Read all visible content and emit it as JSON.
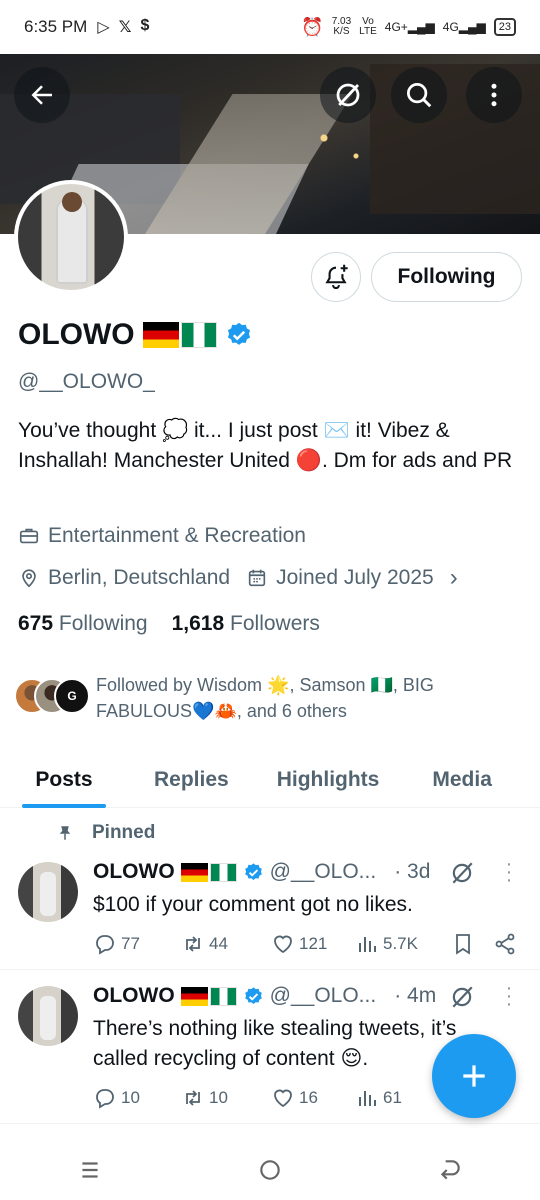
{
  "status_bar": {
    "time": "6:35 PM",
    "speed_value": "7.03",
    "speed_unit": "K/S",
    "carrier_top": "Vo",
    "carrier_bottom": "LTE",
    "net1": "4G+",
    "net2": "4G",
    "battery": "23",
    "icons": [
      "media-output-icon",
      "x-app-icon",
      "s-app-icon",
      "alarm-icon",
      "signal-icon",
      "battery-icon"
    ]
  },
  "header": {
    "icons": [
      "back-arrow-icon",
      "grok-icon",
      "search-icon",
      "more-vertical-icon"
    ]
  },
  "profile": {
    "following_button": "Following",
    "display_name": "OLOWO",
    "handle": "@__OLOWO_",
    "bio": "You’ve thought 💭 it... I just post ✉️ it! Vibez & Inshallah! Manchester United 🔴. Dm for ads and PR",
    "category": "Entertainment & Recreation",
    "location": "Berlin, Deutschland",
    "joined": "Joined July 2025",
    "following_count": "675",
    "following_label": "Following",
    "followers_count": "1,618",
    "followers_label": "Followers",
    "followed_by": "Followed by Wisdom 🌟, Samson 🇳🇬, BIG FABULOUS💙🦀, and 6 others",
    "followed_avatar_badge": "G",
    "accent_color": "#1d9bf0"
  },
  "tabs": [
    {
      "label": "Posts",
      "active": true
    },
    {
      "label": "Replies",
      "active": false
    },
    {
      "label": "Highlights",
      "active": false
    },
    {
      "label": "Media",
      "active": false
    }
  ],
  "pinned_label": "Pinned",
  "posts": [
    {
      "name": "OLOWO",
      "handle": "@__OLO...",
      "time": "· 3d",
      "text": "$100 if your comment got no likes.",
      "replies": "77",
      "reposts": "44",
      "likes": "121",
      "views": "5.7K"
    },
    {
      "name": "OLOWO",
      "handle": "@__OLO...",
      "time": "· 4m",
      "text": "There’s nothing like stealing tweets, it’s called recycling of content 😌.",
      "replies": "10",
      "reposts": "10",
      "likes": "16",
      "views": "61"
    }
  ],
  "fab_icon": "plus-icon",
  "nav": [
    "recents-icon",
    "home-circle-icon",
    "back-icon"
  ]
}
